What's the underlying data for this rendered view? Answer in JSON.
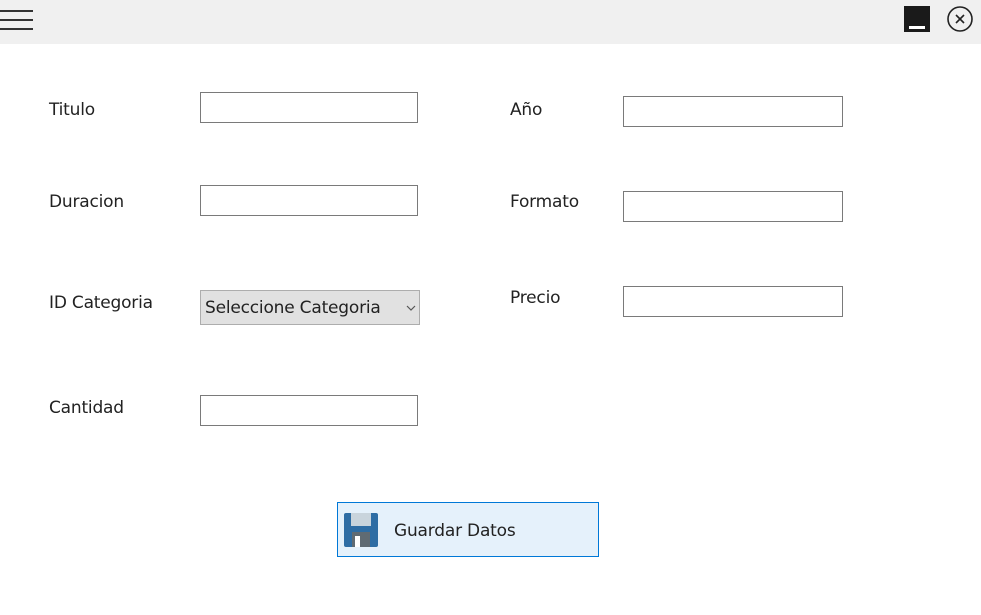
{
  "window": {
    "menu_icon": "hamburger-menu-icon",
    "minimize_icon": "minimize-icon",
    "close_icon": "close-circle-icon"
  },
  "form": {
    "titulo": {
      "label": "Titulo",
      "value": ""
    },
    "anio": {
      "label": "Año",
      "value": ""
    },
    "duracion": {
      "label": "Duracion",
      "value": ""
    },
    "formato": {
      "label": "Formato",
      "value": ""
    },
    "id_categoria": {
      "label": "ID Categoria",
      "selected": "Seleccione Categoria"
    },
    "precio": {
      "label": "Precio",
      "value": ""
    },
    "cantidad": {
      "label": "Cantidad",
      "value": ""
    }
  },
  "actions": {
    "save_label": "Guardar Datos",
    "save_icon": "floppy-disk-icon"
  },
  "colors": {
    "titlebar_bg": "#f0f0f0",
    "button_border": "#0078d7",
    "button_bg": "#e5f1fb",
    "floppy_blue": "#2e6da4",
    "floppy_gray": "#606b73"
  }
}
